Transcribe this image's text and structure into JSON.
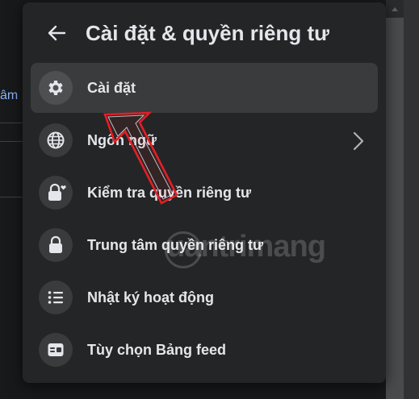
{
  "background": {
    "left_text": "âm"
  },
  "panel": {
    "title": "Cài đặt & quyền riêng tư",
    "items": [
      {
        "label": "Cài đặt",
        "icon": "gear-icon",
        "active": true
      },
      {
        "label": "Ngôn ngữ",
        "icon": "globe-icon",
        "has_submenu": true
      },
      {
        "label": "Kiểm tra quyền riêng tư",
        "icon": "lock-heart-icon"
      },
      {
        "label": "Trung tâm quyền riêng tư",
        "icon": "lock-icon"
      },
      {
        "label": "Nhật ký hoạt động",
        "icon": "list-icon"
      },
      {
        "label": "Tùy chọn Bảng feed",
        "icon": "feed-icon"
      }
    ]
  },
  "watermark": {
    "text": "uantrimang"
  },
  "colors": {
    "panel_bg": "#242526",
    "active_bg": "#3a3b3c",
    "text": "#e4e6eb",
    "annotation_arrow": "#e41e26"
  }
}
